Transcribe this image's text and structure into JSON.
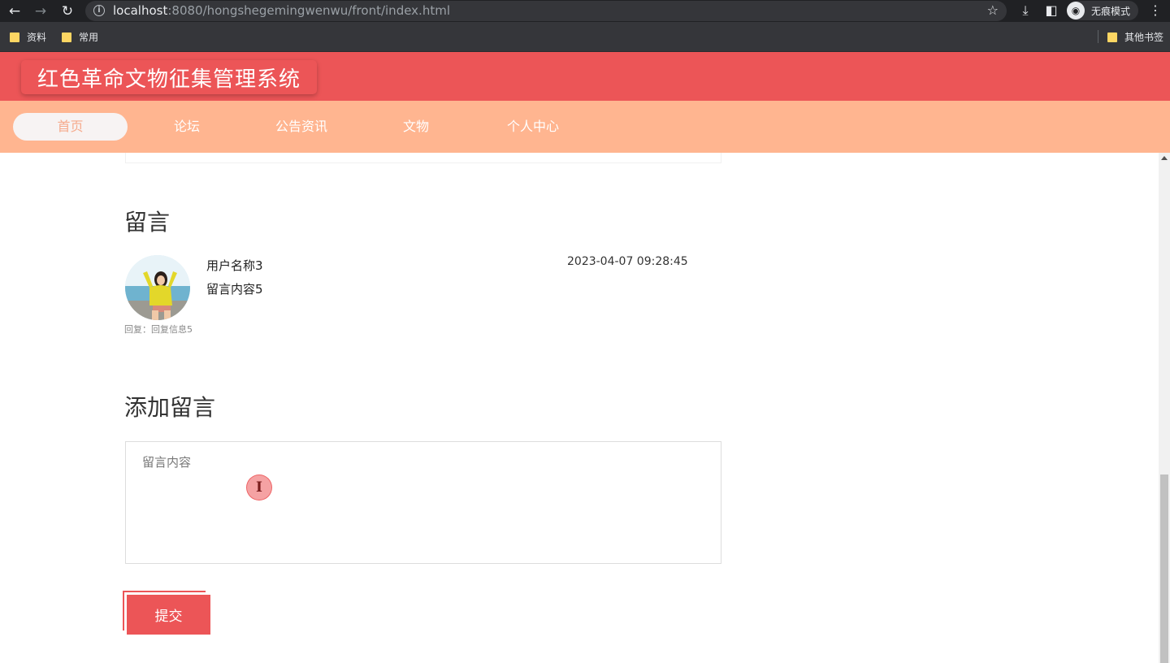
{
  "browser": {
    "url_host": "localhost",
    "url_rest": ":8080/hongshegemingwenwu/front/index.html",
    "incognito_label": "无痕模式",
    "bookmarks": [
      "资料",
      "常用"
    ],
    "other_bookmarks": "其他书签"
  },
  "site": {
    "title": "红色革命文物征集管理系统",
    "nav": [
      "首页",
      "论坛",
      "公告资讯",
      "文物",
      "个人中心"
    ],
    "active_nav": "首页"
  },
  "messages": {
    "heading": "留言",
    "items": [
      {
        "user": "用户名称3",
        "content": "留言内容5",
        "time": "2023-04-07 09:28:45",
        "reply": "回复：回复信息5"
      }
    ]
  },
  "add_message": {
    "heading": "添加留言",
    "placeholder": "留言内容",
    "submit_label": "提交"
  },
  "colors": {
    "header": "#ec5557",
    "nav": "#ffb590",
    "accent": "#ec5557"
  }
}
